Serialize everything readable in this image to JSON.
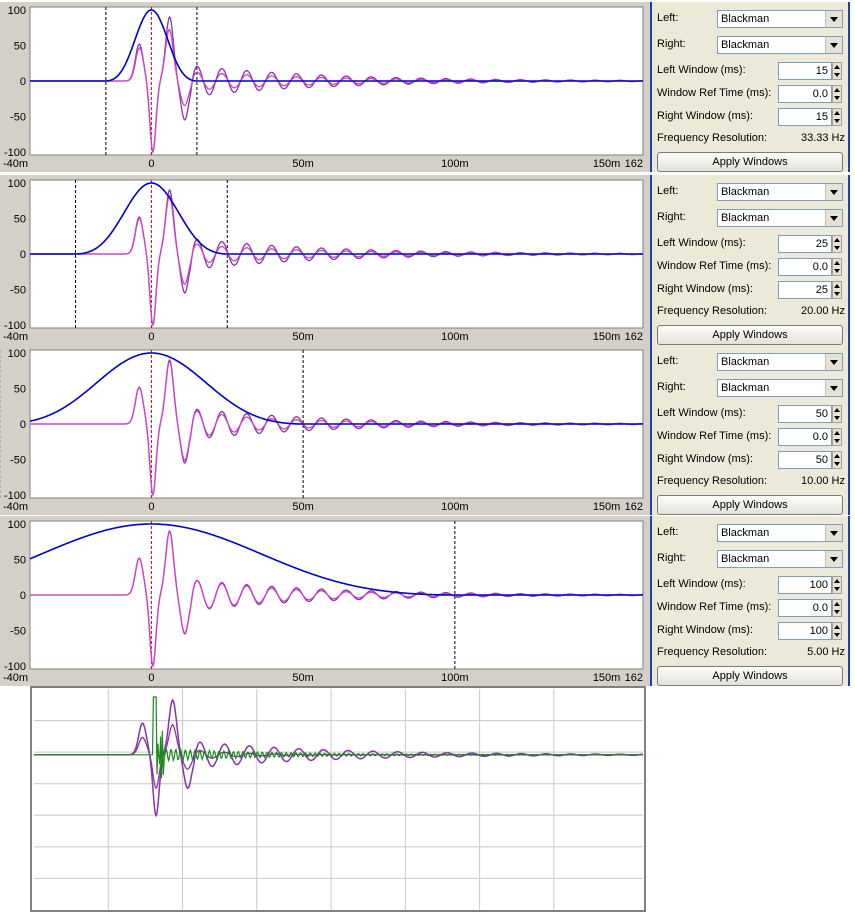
{
  "axis": {
    "y_ticks": [
      "100",
      "50",
      "0",
      "-50",
      "-100"
    ],
    "x_ticks": [
      "-40m",
      "0",
      "50m",
      "100m",
      "150m",
      "162"
    ]
  },
  "labels": {
    "left": "Left:",
    "right": "Right:",
    "left_window": "Left Window (ms):",
    "ref_time": "Window Ref Time (ms):",
    "right_window": "Right Window (ms):",
    "freq_res": "Frequency Resolution:",
    "apply": "Apply Windows"
  },
  "panels": [
    {
      "left_type": "Blackman",
      "right_type": "Blackman",
      "left_ms": "15",
      "ref_ms": "0.0",
      "right_ms": "15",
      "freq_res": "33.33 Hz"
    },
    {
      "left_type": "Blackman",
      "right_type": "Blackman",
      "left_ms": "25",
      "ref_ms": "0.0",
      "right_ms": "25",
      "freq_res": "20.00 Hz"
    },
    {
      "left_type": "Blackman",
      "right_type": "Blackman",
      "left_ms": "50",
      "ref_ms": "0.0",
      "right_ms": "50",
      "freq_res": "10.00 Hz"
    },
    {
      "left_type": "Blackman",
      "right_type": "Blackman",
      "left_ms": "100",
      "ref_ms": "0.0",
      "right_ms": "100",
      "freq_res": "5.00 Hz"
    }
  ],
  "chart_data": [
    {
      "type": "line",
      "x_unit": "ms",
      "xlim": [
        -40,
        162
      ],
      "ylim": [
        -100,
        100
      ],
      "window_ms": 15,
      "series": [
        {
          "color": "#0000cc"
        },
        {
          "color": "#cc44cc"
        },
        {
          "color": "#8833aa"
        }
      ]
    },
    {
      "type": "line",
      "x_unit": "ms",
      "xlim": [
        -40,
        162
      ],
      "ylim": [
        -100,
        100
      ],
      "window_ms": 25,
      "series": [
        {
          "color": "#0000cc"
        },
        {
          "color": "#cc44cc"
        },
        {
          "color": "#8833aa"
        }
      ]
    },
    {
      "type": "line",
      "x_unit": "ms",
      "xlim": [
        -40,
        162
      ],
      "ylim": [
        -100,
        100
      ],
      "window_ms": 50,
      "series": [
        {
          "color": "#0000cc"
        },
        {
          "color": "#cc44cc"
        },
        {
          "color": "#8833aa"
        }
      ]
    },
    {
      "type": "line",
      "x_unit": "ms",
      "xlim": [
        -40,
        162
      ],
      "ylim": [
        -100,
        100
      ],
      "window_ms": 100,
      "series": [
        {
          "color": "#0000cc"
        },
        {
          "color": "#cc44cc"
        },
        {
          "color": "#8833aa"
        }
      ]
    },
    {
      "type": "line",
      "x_unit": "ms",
      "xlim": [
        -40,
        162
      ],
      "ylim": [
        -100,
        100
      ],
      "grid": true,
      "series": [
        {
          "color": "#8833aa"
        },
        {
          "color": "#1a8a1a"
        }
      ]
    }
  ]
}
